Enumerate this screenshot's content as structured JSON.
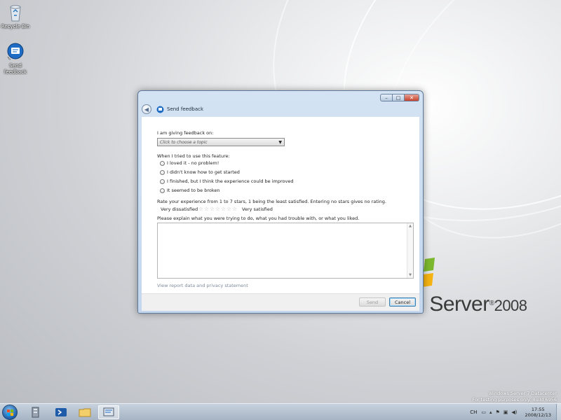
{
  "desktop": {
    "icons": [
      {
        "label": "Recycle Bin"
      },
      {
        "label": "Send feedback"
      }
    ],
    "brand": {
      "text": "s Server",
      "year": "2008",
      "tm": "®"
    },
    "watermark": {
      "line1": "Windows Server 7 Datacenter",
      "line2": "For testing purposes only. Build 6956"
    }
  },
  "window": {
    "title": "Send feedback",
    "caption_buttons": {
      "minimize": "–",
      "maximize": "□",
      "close": "✕"
    },
    "back_glyph": "◀",
    "topic_label": "I am giving feedback on:",
    "topic_placeholder": "Click to choose a topic",
    "feature_label": "When I tried to use this feature:",
    "options": [
      "I loved it - no problem!",
      "I didn't know how to get started",
      "I finished, but I think the experience could be improved",
      "It seemed to be broken"
    ],
    "rating_label": "Rate your experience from 1 to 7 stars, 1 being the least satisfied.  Entering no stars gives no rating.",
    "rating_low": "Very dissatisfied",
    "rating_high": "Very satisfied",
    "rating_value": 0,
    "rating_max": 7,
    "explain_label": "Please explain what you were trying to do, what you had trouble with, or what you liked.",
    "explain_value": "",
    "privacy_link": "View report data and privacy statement",
    "send_label": "Send",
    "cancel_label": "Cancel"
  },
  "taskbar": {
    "language": "CH",
    "clock_time": "17:55",
    "clock_date": "2008/12/13"
  },
  "colors": {
    "accent": "#3c7fb1",
    "titlebar": "#c4d7ee",
    "close_button": "#c4432e"
  }
}
